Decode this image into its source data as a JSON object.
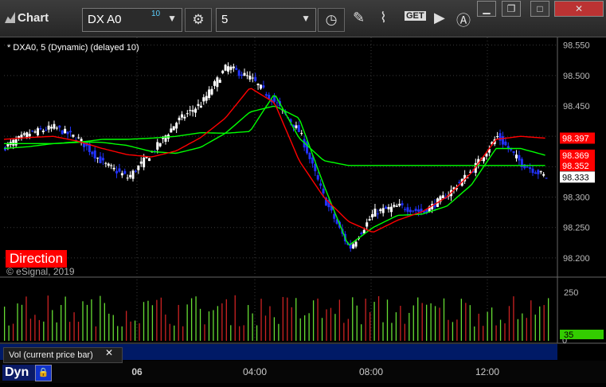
{
  "window": {
    "title": "Chart",
    "controls": [
      "minimize",
      "restore",
      "maximize",
      "close"
    ]
  },
  "toolbar": {
    "symbol": "DX A0",
    "symbol_superscript": "10",
    "interval": "5",
    "icons": [
      "settings-gear-icon",
      "clock-icon",
      "pencil-icon",
      "study-icon",
      "get-icon",
      "play-icon",
      "alert-icon"
    ],
    "get_label": "GET"
  },
  "chart": {
    "study_title": "* DXA0, 5 (Dynamic) (delayed 10)",
    "direction_label": "Direction",
    "copyright": "© eSignal, 2019",
    "price_axis": [
      "98.550",
      "98.500",
      "98.450",
      "98.400",
      "98.350",
      "98.300",
      "98.250",
      "98.200"
    ],
    "price_tags": [
      {
        "value": "98.397",
        "color": "#ff0000"
      },
      {
        "value": "98.369",
        "color": "#ff0000"
      },
      {
        "value": "98.352",
        "color": "#ff0000"
      },
      {
        "value": "98.333",
        "color": "#ffffff"
      }
    ],
    "time_axis": [
      "06",
      "04:00",
      "08:00",
      "12:00"
    ],
    "colors": {
      "up_bar": "#ffffff",
      "down_bar": "#2233ff",
      "ma_fast": "#00ff00",
      "ma_slow": "#ff0000",
      "vol_up": "#66dd33",
      "vol_down": "#cc2222"
    }
  },
  "chart_data": {
    "type": "line",
    "title": "* DXA0, 5 (Dynamic) (delayed 10)",
    "xlabel": "",
    "ylabel": "",
    "x": [
      "06",
      "04:00",
      "08:00",
      "12:00"
    ],
    "ylim": [
      98.175,
      98.56
    ],
    "grid": true,
    "series": [
      {
        "values": [
          98.383,
          98.405,
          98.415,
          98.395,
          98.355,
          98.332,
          98.375,
          98.425,
          98.455,
          98.515,
          98.495,
          98.455,
          98.405,
          98.295,
          98.215,
          98.275,
          98.285,
          98.275,
          98.305,
          98.345,
          98.4,
          98.355,
          98.333
        ]
      },
      {
        "values": [
          98.38,
          98.383,
          98.388,
          98.391,
          98.39,
          98.385,
          98.375,
          98.372,
          98.382,
          98.405,
          98.44,
          98.45,
          98.43,
          98.32,
          98.22,
          98.25,
          98.27,
          98.272,
          98.285,
          98.32,
          98.38,
          98.38,
          98.369
        ]
      },
      {
        "values": [
          98.388,
          98.388,
          98.388,
          98.39,
          98.395,
          98.395,
          98.397,
          98.4,
          98.406,
          98.405,
          98.408,
          98.47,
          98.397,
          98.36,
          98.352,
          98.352,
          98.352,
          98.352,
          98.352,
          98.352,
          98.352,
          98.352,
          98.352
        ]
      },
      {
        "values": [
          98.395,
          98.398,
          98.4,
          98.392,
          98.38,
          98.37,
          98.366,
          98.376,
          98.398,
          98.43,
          98.48,
          98.455,
          98.36,
          98.3,
          98.26,
          98.242,
          98.262,
          98.276,
          98.3,
          98.34,
          98.395,
          98.4,
          98.397
        ]
      }
    ],
    "volume": {
      "axis": [
        "250",
        "0"
      ],
      "current_value": "35",
      "label": "Vol (current price bar)"
    }
  },
  "status": {
    "mode": "Dyn"
  }
}
